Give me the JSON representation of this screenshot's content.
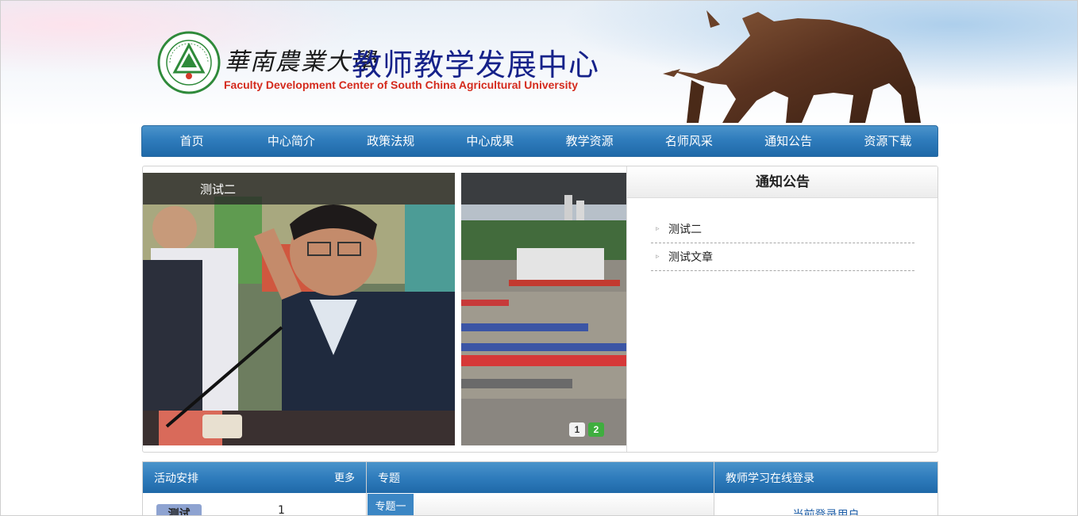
{
  "header": {
    "brand_cn": "華南農業大學",
    "title": "教师教学发展中心",
    "subtitle_en": "Faculty Development Center of South China Agricultural University",
    "logo_icon": "scau-seal-logo",
    "mascot_icon": "bull-statue"
  },
  "nav": {
    "items": [
      {
        "label": "首页"
      },
      {
        "label": "中心简介"
      },
      {
        "label": "政策法规"
      },
      {
        "label": "中心成果"
      },
      {
        "label": "教学资源"
      },
      {
        "label": "名师风采"
      },
      {
        "label": "通知公告"
      },
      {
        "label": "资源下载"
      }
    ]
  },
  "slideshow": {
    "caption": "测试二",
    "dots": [
      "1",
      "2"
    ]
  },
  "notice": {
    "title": "通知公告",
    "items": [
      {
        "label": "测试二"
      },
      {
        "label": "测试文章"
      }
    ]
  },
  "activity": {
    "title": "活动安排",
    "more": "更多",
    "tag": "测试",
    "number": "1"
  },
  "topic": {
    "title": "专题",
    "tab": "专题一"
  },
  "login": {
    "title": "教师学习在线登录",
    "user_text": "当前登录用户"
  },
  "colors": {
    "nav_blue": "#2f7cbc",
    "title_blue": "#16228a",
    "subtitle_red": "#d42a1c",
    "dot_active": "#3fae3f"
  }
}
